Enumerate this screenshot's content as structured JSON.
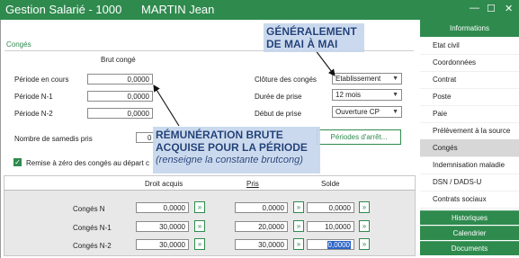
{
  "window": {
    "title": "Gestion Salarié - 1000",
    "employee": "MARTIN Jean",
    "minimize": "—",
    "maximize": "☐",
    "close": "✕"
  },
  "section": {
    "title": "Congés"
  },
  "brut": {
    "header": "Brut congé",
    "rows": [
      {
        "label": "Période en cours",
        "value": "0,0000"
      },
      {
        "label": "Période N-1",
        "value": "0,0000"
      },
      {
        "label": "Période N-2",
        "value": "0,0000"
      }
    ]
  },
  "settings": {
    "cloture_label": "Clôture des congés",
    "cloture_value": "Etablissement",
    "duree_label": "Durée de prise",
    "duree_value": "12 mois",
    "debut_label": "Début de prise",
    "debut_value": "Ouverture CP"
  },
  "samedis": {
    "label": "Nombre de samedis pris",
    "value": "0"
  },
  "periodes_button": "Périodes d'arrêt...",
  "reset": {
    "label": "Remise à zéro des congés au départ c"
  },
  "table": {
    "headers": [
      "Droit acquis",
      "Pris",
      "Solde"
    ],
    "rows": [
      {
        "label": "Congés N",
        "acquis": "0,0000",
        "pris": "0,0000",
        "solde": "0,0000"
      },
      {
        "label": "Congés N-1",
        "acquis": "30,0000",
        "pris": "20,0000",
        "solde": "10,0000"
      },
      {
        "label": "Congés N-2",
        "acquis": "30,0000",
        "pris": "30,0000",
        "solde": "0,0000"
      }
    ],
    "step_label": "»"
  },
  "sidebar": {
    "header": "Informations",
    "items": [
      "Etat civil",
      "Coordonnées",
      "Contrat",
      "Poste",
      "Paie",
      "Prélèvement à la source",
      "Congés",
      "Indemnisation maladie",
      "DSN / DADS-U",
      "Contrats sociaux"
    ],
    "active_index": 6,
    "footer": [
      "Historiques",
      "Calendrier",
      "Documents"
    ]
  },
  "annotations": {
    "top": [
      "GÉNÉRALEMENT",
      "DE MAI À MAI"
    ],
    "bottom": [
      "RÉMUNÉRATION BRUTE",
      "ACQUISE POUR LA PÉRIODE"
    ],
    "bottom_note": "(renseigne la constante brutcong)"
  },
  "colors": {
    "brand_green": "#2f8a4e",
    "callout_blue": "#1f3f7a",
    "callout_bg": "#c6d6ec",
    "selected_blue": "#2a63c9"
  }
}
